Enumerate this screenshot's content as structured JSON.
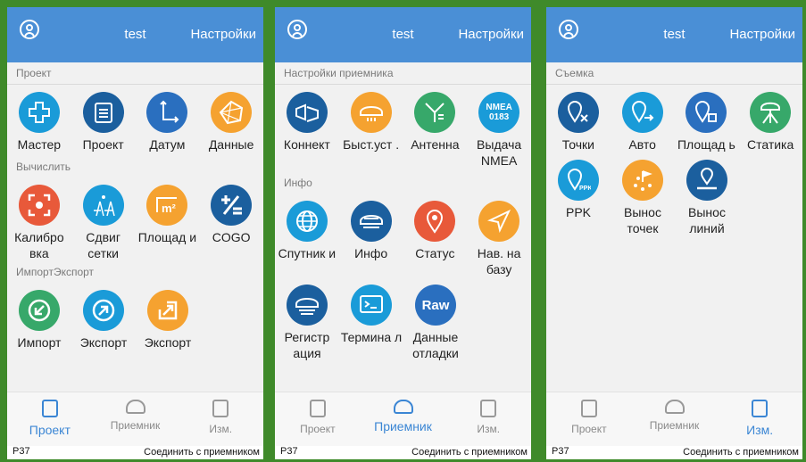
{
  "colors": {
    "header": "#4a8fd6",
    "teal": "#1a9bd8",
    "navy": "#1b5f9e",
    "blue": "#2a6fbf",
    "orange": "#f5a230",
    "red": "#e8593a",
    "green": "#37a86a",
    "active": "#3b86d4"
  },
  "panels": [
    {
      "header": {
        "title": "test",
        "settings": "Настройки"
      },
      "sections": [
        {
          "label": "Проект",
          "items": [
            {
              "label": "Мастер",
              "icon": "plus-icon",
              "color": "#1a9bd8"
            },
            {
              "label": "Проект",
              "icon": "clipboard-icon",
              "color": "#1b5f9e"
            },
            {
              "label": "Датум",
              "icon": "axes-icon",
              "color": "#2a6fbf"
            },
            {
              "label": "Данные",
              "icon": "network-icon",
              "color": "#f5a230"
            }
          ]
        },
        {
          "label": "Вычислить",
          "items": [
            {
              "label": "Калибро вка",
              "icon": "calibrate-icon",
              "color": "#e8593a"
            },
            {
              "label": "Сдвиг сетки",
              "icon": "grid-shift-icon",
              "color": "#1a9bd8"
            },
            {
              "label": "Площад и",
              "icon": "area-icon",
              "color": "#f5a230"
            },
            {
              "label": "COGO",
              "icon": "plus-minus-icon",
              "color": "#1b5f9e"
            }
          ]
        },
        {
          "label": "ИмпортЭкспорт",
          "items": [
            {
              "label": "Импорт",
              "icon": "import-icon",
              "color": "#37a86a"
            },
            {
              "label": "Экспорт",
              "icon": "export-icon",
              "color": "#1a9bd8"
            },
            {
              "label": "Экспорт",
              "icon": "export-up-icon",
              "color": "#f5a230"
            }
          ]
        }
      ],
      "nav": [
        {
          "label": "Проект",
          "active": true
        },
        {
          "label": "Приемник",
          "active": false
        },
        {
          "label": "Изм.",
          "active": false
        }
      ],
      "status": {
        "battery": "P37",
        "connect": "Соединить с приемником"
      }
    },
    {
      "header": {
        "title": "test",
        "settings": "Настройки"
      },
      "sections": [
        {
          "label": "Настройки приемника",
          "items": [
            {
              "label": "Коннект",
              "icon": "connect-icon",
              "color": "#1b5f9e"
            },
            {
              "label": "Быст.уст .",
              "icon": "receiver-icon",
              "color": "#f5a230"
            },
            {
              "label": "Антенна",
              "icon": "antenna-icon",
              "color": "#37a86a"
            },
            {
              "label": "Выдача NMEA",
              "icon": "nmea-icon",
              "color": "#1a9bd8"
            }
          ]
        },
        {
          "label": "Инфо",
          "items": [
            {
              "label": "Спутник и",
              "icon": "globe-icon",
              "color": "#1a9bd8"
            },
            {
              "label": "Инфо",
              "icon": "receiver-info-icon",
              "color": "#1b5f9e"
            },
            {
              "label": "Статус",
              "icon": "location-icon",
              "color": "#e8593a"
            },
            {
              "label": "Нав. на базу",
              "icon": "navigate-icon",
              "color": "#f5a230"
            }
          ]
        },
        {
          "label": "",
          "items": [
            {
              "label": "Регистр ация",
              "icon": "record-icon",
              "color": "#1b5f9e"
            },
            {
              "label": "Термина л",
              "icon": "terminal-icon",
              "color": "#1a9bd8"
            },
            {
              "label": "Данные отладки",
              "icon": "raw-icon",
              "color": "#2a6fbf"
            }
          ]
        }
      ],
      "nav": [
        {
          "label": "Проект",
          "active": false
        },
        {
          "label": "Приемник",
          "active": true
        },
        {
          "label": "Изм.",
          "active": false
        }
      ],
      "status": {
        "battery": "P37",
        "connect": "Соединить с приемником"
      }
    },
    {
      "header": {
        "title": "test",
        "settings": "Настройки"
      },
      "sections": [
        {
          "label": "Съемка",
          "items": [
            {
              "label": "Точки",
              "icon": "point-icon",
              "color": "#1b5f9e"
            },
            {
              "label": "Авто",
              "icon": "auto-icon",
              "color": "#1a9bd8"
            },
            {
              "label": "Площад ь",
              "icon": "area-point-icon",
              "color": "#2a6fbf"
            },
            {
              "label": "Статика",
              "icon": "static-icon",
              "color": "#37a86a"
            }
          ]
        },
        {
          "label": "",
          "items": [
            {
              "label": "PPK",
              "icon": "ppk-icon",
              "color": "#1a9bd8"
            },
            {
              "label": "Вынос точек",
              "icon": "stakeout-points-icon",
              "color": "#f5a230"
            },
            {
              "label": "Вынос линий",
              "icon": "stakeout-lines-icon",
              "color": "#1b5f9e"
            }
          ]
        }
      ],
      "nav": [
        {
          "label": "Проект",
          "active": false
        },
        {
          "label": "Приемник",
          "active": false
        },
        {
          "label": "Изм.",
          "active": true
        }
      ],
      "status": {
        "battery": "P37",
        "connect": "Соединить с приемником"
      }
    }
  ],
  "glyphs": {
    "nmea": "NMEA 0183",
    "raw": "Raw"
  }
}
